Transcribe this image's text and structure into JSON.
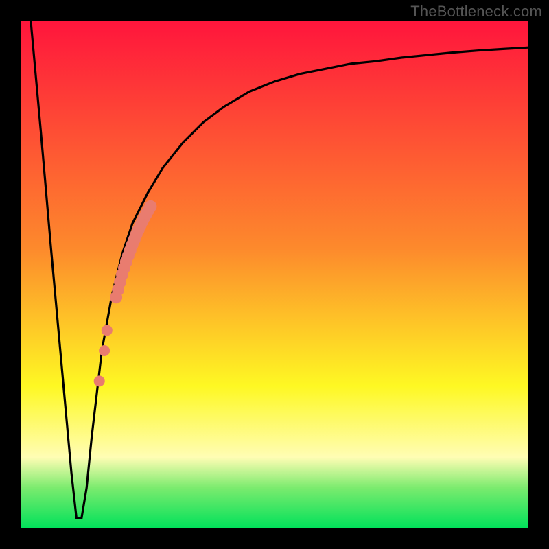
{
  "attribution": "TheBottleneck.com",
  "colors": {
    "frame": "#000000",
    "curve": "#000000",
    "marker": "#e97c6f",
    "gradient_top": "#ff153c",
    "gradient_mid_upper": "#fd8a2c",
    "gradient_mid": "#fef823",
    "gradient_yellow_white": "#fffdb4",
    "gradient_green_light": "#7beb6e",
    "gradient_green": "#00e15a"
  },
  "chart_data": {
    "type": "line",
    "title": "",
    "xlabel": "",
    "ylabel": "",
    "xlim": [
      0,
      100
    ],
    "ylim": [
      0,
      100
    ],
    "curve": {
      "x": [
        2,
        4,
        6,
        8,
        10,
        11,
        12,
        13,
        14,
        16,
        18,
        20,
        22,
        25,
        28,
        32,
        36,
        40,
        45,
        50,
        55,
        60,
        65,
        70,
        75,
        80,
        85,
        90,
        95,
        100
      ],
      "y": [
        100,
        78,
        55,
        33,
        11,
        2,
        2,
        8,
        18,
        35,
        46,
        54,
        60,
        66,
        71,
        76,
        80,
        83,
        86,
        88,
        89.5,
        90.5,
        91.5,
        92,
        92.7,
        93.2,
        93.7,
        94.1,
        94.4,
        94.7
      ]
    },
    "markers": {
      "x": [
        15.5,
        16.5,
        17.0,
        18.8,
        19.2,
        19.6,
        20.0,
        20.4,
        20.8,
        21.2,
        21.6,
        22.0,
        22.4,
        22.8,
        23.2,
        23.6,
        24.0,
        24.4,
        24.8,
        25.2,
        25.6
      ],
      "y": [
        29.0,
        35.0,
        39.0,
        45.5,
        47.0,
        48.5,
        50.0,
        51.3,
        52.5,
        53.7,
        54.8,
        55.9,
        56.9,
        57.9,
        58.8,
        59.7,
        60.5,
        61.3,
        62.0,
        62.7,
        63.4
      ]
    },
    "valley_x": 11.5,
    "annotations": []
  }
}
